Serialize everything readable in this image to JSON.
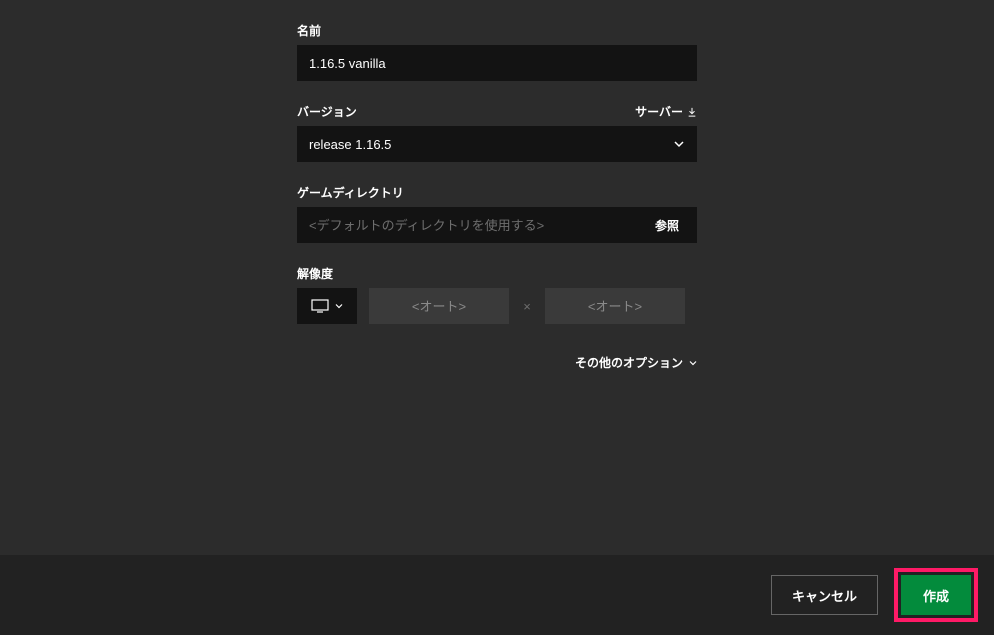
{
  "fields": {
    "name": {
      "label": "名前",
      "value": "1.16.5 vanilla"
    },
    "version": {
      "label": "バージョン",
      "server_link": "サーバー",
      "selected": "release 1.16.5"
    },
    "directory": {
      "label": "ゲームディレクトリ",
      "placeholder": "<デフォルトのディレクトリを使用する>",
      "browse_label": "参照"
    },
    "resolution": {
      "label": "解像度",
      "width_placeholder": "<オート>",
      "height_placeholder": "<オート>",
      "separator": "×"
    }
  },
  "other_options_label": "その他のオプション",
  "footer": {
    "cancel_label": "キャンセル",
    "create_label": "作成"
  }
}
